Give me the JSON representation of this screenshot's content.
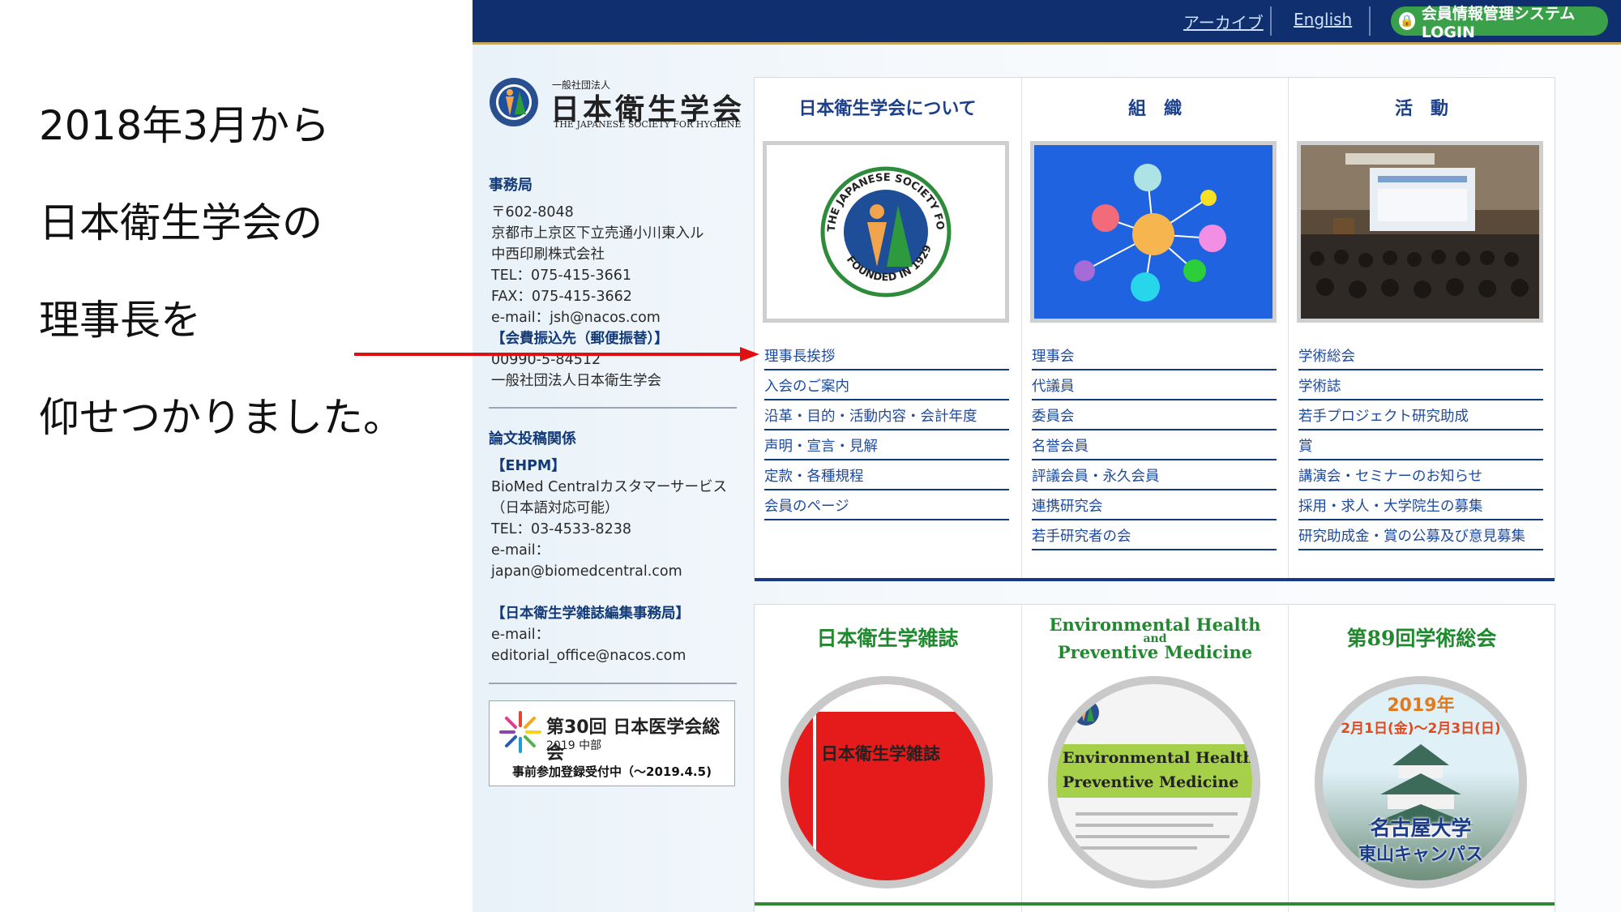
{
  "slide": {
    "lines": [
      "2018年3月から",
      "日本衛生学会の",
      "理事長を",
      "仰せつかりました。"
    ]
  },
  "colors": {
    "topbar": "#0f2f6e",
    "link_blue": "#1e4aa0",
    "title_green": "#1f8a2d",
    "arrow_red": "#e01010",
    "login_green": "#3aa14a"
  },
  "topbar": {
    "archive": "アーカイブ",
    "english": "English",
    "login": "会員情報管理システムLOGIN"
  },
  "logo": {
    "small": "一般社団法人",
    "main": "日本衛生学会",
    "en": "THE JAPANESE SOCIETY FOR HYGIENE",
    "icon": "society-emblem-icon"
  },
  "office": {
    "heading": "事務局",
    "lines": [
      "〒602-8048",
      "京都市上京区下立売通小川東入ル",
      "中西印刷株式会社",
      "TEL：075-415-3661",
      "FAX：075-415-3662",
      "e-mail：jsh@nacos.com"
    ],
    "transfer_label": "【会費振込先（郵便振替）】",
    "transfer_lines": [
      "00990-5-84512",
      "一般社団法人日本衛生学会"
    ]
  },
  "submission": {
    "heading": "論文投稿関係",
    "ehpm_label": "【EHPM】",
    "ehpm_lines": [
      "BioMed Centralカスタマーサービス",
      "（日本語対応可能）",
      "TEL：03-4533-8238",
      "e-mail：",
      "japan@biomedcentral.com"
    ],
    "editorial_label": "【日本衛生学雑誌編集事務局】",
    "editorial_lines": [
      "e-mail：",
      "editorial_office@nacos.com"
    ]
  },
  "banner": {
    "title": "第30回 日本医学会総会",
    "sub": "2019 中部",
    "note": "事前参加登録受付中（～2019.4.5)"
  },
  "columns": [
    {
      "title": "日本衛生学会について",
      "image": "society-seal-image",
      "seal_text": "THE JAPANESE SOCIETY FOR HYGIENE",
      "seal_bottom": "FOUNDED IN 1929",
      "links": [
        "理事長挨拶",
        "入会のご案内",
        "沿革・目的・活動内容・会計年度",
        "声明・宣言・見解",
        "定款・各種規程",
        "会員のページ"
      ]
    },
    {
      "title": "組　織",
      "image": "network-diagram-image",
      "links": [
        "理事会",
        "代議員",
        "委員会",
        "名誉会員",
        "評議会員・永久会員",
        "連携研究会",
        "若手研究者の会"
      ]
    },
    {
      "title": "活　動",
      "image": "conference-photo-image",
      "links": [
        "学術総会",
        "学術誌",
        "若手プロジェクト研究助成",
        "賞",
        "講演会・セミナーのお知らせ",
        "採用・求人・大学院生の募集",
        "研究助成金・賞の公募及び意見募集"
      ]
    }
  ],
  "bottom_columns": [
    {
      "title": "日本衛生学雑誌",
      "circle_text": "日本衛生学雑誌"
    },
    {
      "title_line1": "Environmental Health",
      "title_line2": "and",
      "title_line3": "Preventive Medicine",
      "circle_line1": "Environmental Health",
      "circle_line2": "Preventive Medicine"
    },
    {
      "title": "第89回学術総会",
      "year": "2019年",
      "dates": "2月1日(金)～2月3日(日)",
      "venue1": "名古屋大学",
      "venue2": "東山キャンパス"
    }
  ]
}
